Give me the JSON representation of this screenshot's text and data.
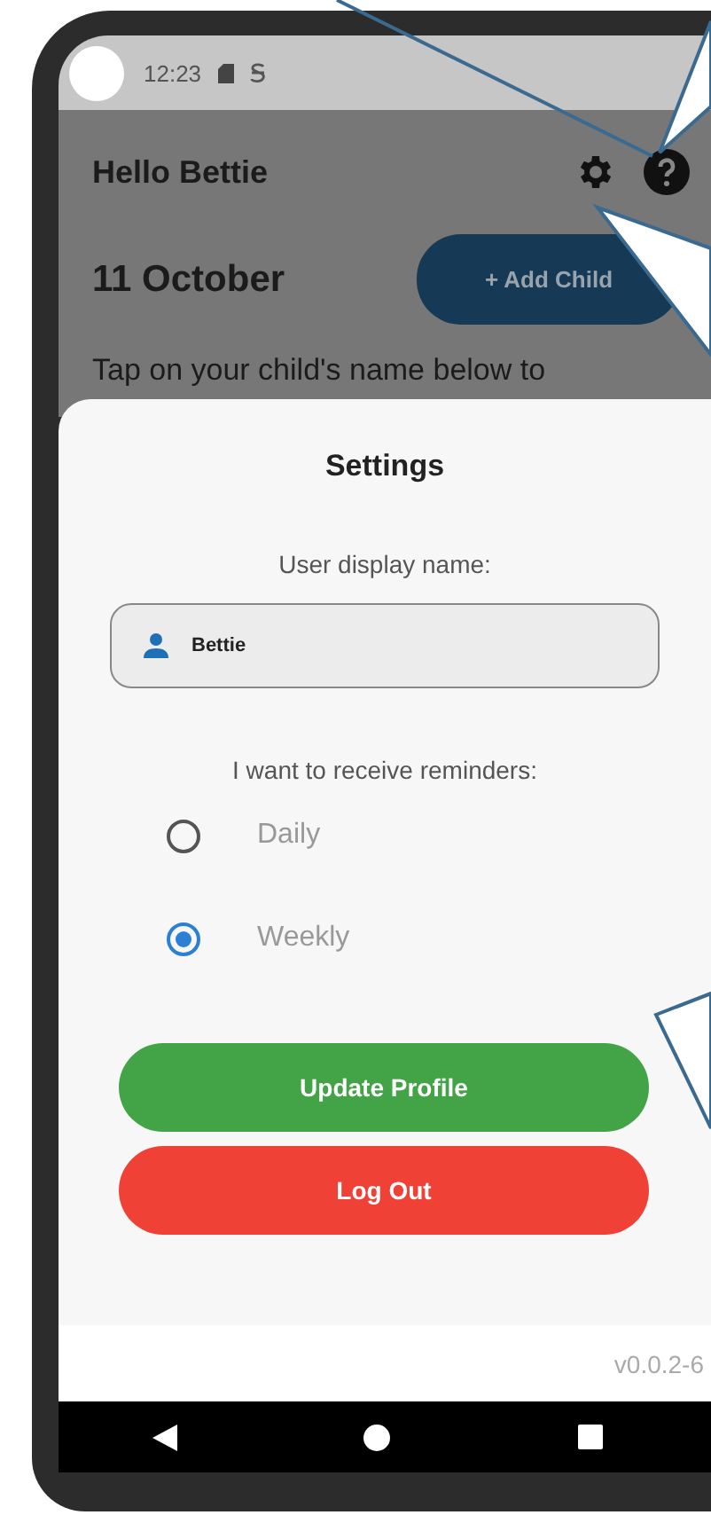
{
  "status_bar": {
    "time": "12:23"
  },
  "header": {
    "greeting": "Hello Bettie"
  },
  "date": "11 October",
  "add_button": "+ Add Child",
  "instruction": "Tap on your child's name below to",
  "settings": {
    "title": "Settings",
    "name_label": "User display name:",
    "name_value": "Bettie",
    "reminder_label": "I want to receive reminders:",
    "options": [
      {
        "label": "Daily",
        "selected": false
      },
      {
        "label": "Weekly",
        "selected": true
      }
    ],
    "buttons": [
      {
        "label": "Update Profile",
        "kind": "primary"
      },
      {
        "label": "Log Out",
        "kind": "danger"
      }
    ]
  },
  "version": "v0.0.2-6"
}
